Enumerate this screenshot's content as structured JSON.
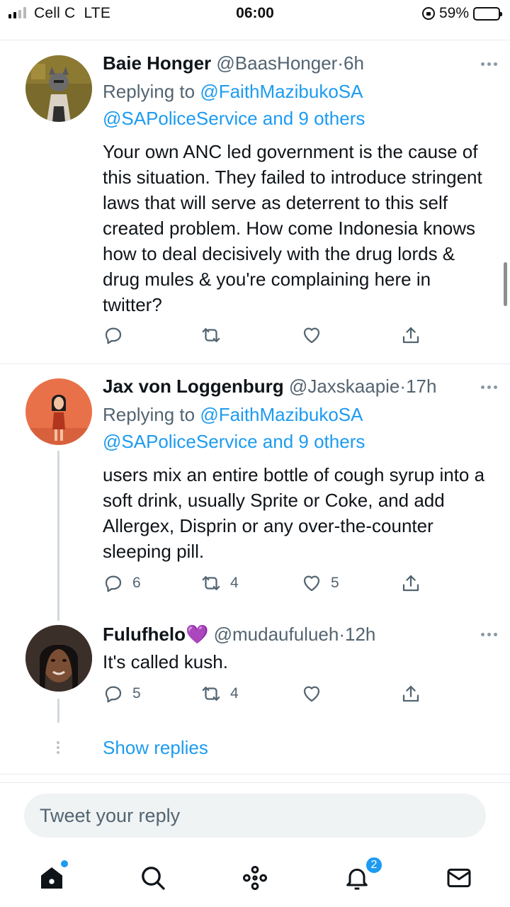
{
  "status_bar": {
    "carrier": "Cell C",
    "network": "LTE",
    "time": "06:00",
    "battery": "59%",
    "battery_level": 0.59
  },
  "tweets": [
    {
      "name": "Baie Honger",
      "handle": "@BaasHonger",
      "time": "6h",
      "replying_label": "Replying to",
      "reply_to_1": "@FaithMazibukoSA",
      "reply_to_2": "@SAPoliceService and 9 others",
      "text": "Your own ANC led government is the cause of this situation. They failed to introduce stringent laws that will serve as deterrent to this self created problem. How come Indonesia knows how to deal decisively with the drug lords & drug mules & you're complaining here in twitter?",
      "replies": "",
      "retweets": "",
      "likes": ""
    },
    {
      "name": "Jax von Loggenburg",
      "handle": "@Jaxskaapie",
      "time": "17h",
      "replying_label": "Replying to",
      "reply_to_1": "@FaithMazibukoSA",
      "reply_to_2": "@SAPoliceService and 9 others",
      "text": "users mix an entire bottle of cough syrup into a soft drink, usually Sprite or Coke, and add Allergex, Disprin or any over-the-counter sleeping pill.",
      "replies": "6",
      "retweets": "4",
      "likes": "5"
    },
    {
      "name": "Fulufhelo",
      "emoji": "💜",
      "handle": "@mudaufulueh",
      "time": "12h",
      "text": "It's called kush.",
      "replies": "5",
      "retweets": "4",
      "likes": ""
    }
  ],
  "separator": "·",
  "show_replies": "Show replies",
  "reply_box": {
    "placeholder": "Tweet your reply"
  },
  "nav": {
    "items": [
      "home-icon",
      "search-icon",
      "spaces-icon",
      "notifications-icon",
      "messages-icon"
    ],
    "notifications_badge": "2"
  },
  "colors": {
    "accent": "#1d9bf0",
    "text": "#0f1419",
    "secondary": "#536471",
    "divider": "#e6ecf0"
  }
}
